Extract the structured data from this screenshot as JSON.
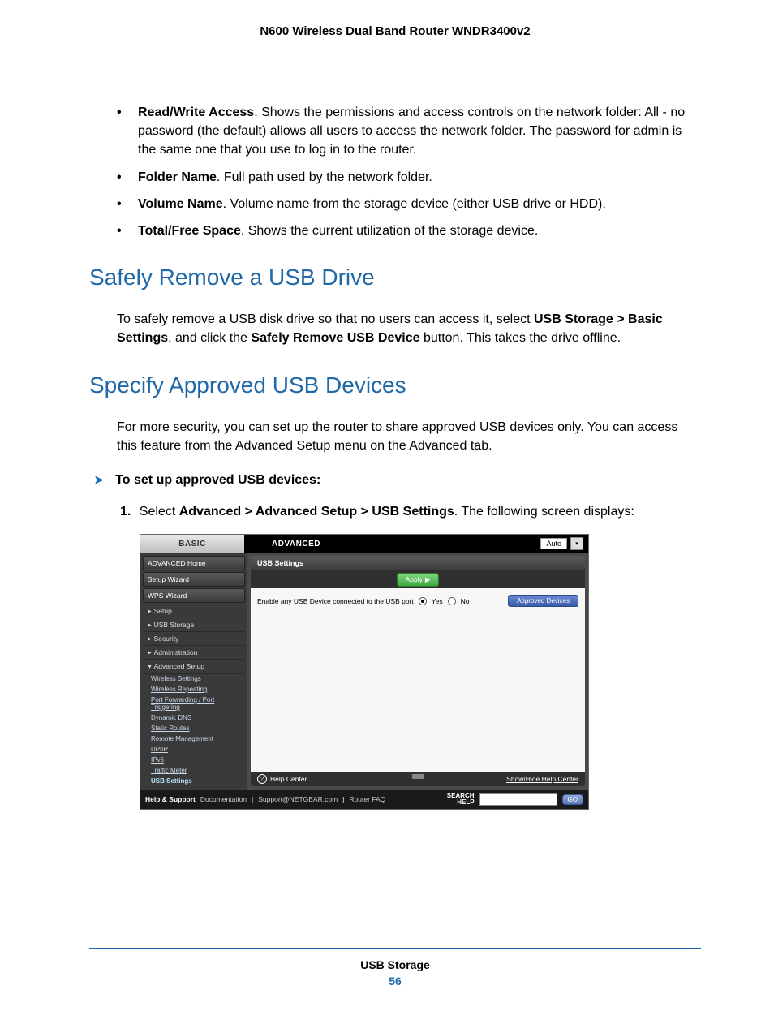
{
  "header": {
    "title": "N600 Wireless Dual Band Router WNDR3400v2"
  },
  "bullets": [
    {
      "term": "Read/Write Access",
      "text": ". Shows the permissions and access controls on the network folder: All - no password (the default) allows all users to access the network folder. The password for admin is the same one that you use to log in to the router."
    },
    {
      "term": "Folder Name",
      "text": ". Full path used by the network folder."
    },
    {
      "term": "Volume Name",
      "text": ". Volume name from the storage device (either USB drive or HDD)."
    },
    {
      "term": "Total/Free Space",
      "text": ". Shows the current utilization of the storage device."
    }
  ],
  "h2a": "Safely Remove a USB Drive",
  "para_a": {
    "pre": "To safely remove a USB disk drive so that no users can access it, select ",
    "b1": "USB Storage > Basic Settings",
    "mid": ", and click the ",
    "b2": "Safely Remove USB Device",
    "post": " button. This takes the drive offline."
  },
  "h2b": "Specify Approved USB Devices",
  "para_b": "For more security, you can set up the router to share approved USB devices only. You can access this feature from the Advanced Setup menu on the Advanced tab.",
  "proc_heading": "To set up approved USB devices:",
  "step1": {
    "pre": "Select ",
    "bold": "Advanced > Advanced Setup > USB Settings",
    "post": ". The following screen displays:"
  },
  "router": {
    "tabs": {
      "basic": "BASIC",
      "advanced": "ADVANCED",
      "auto": "Auto"
    },
    "side_buttons": [
      "ADVANCED Home",
      "Setup Wizard",
      "WPS Wizard"
    ],
    "side_rows": [
      {
        "label": "Setup",
        "expanded": false
      },
      {
        "label": "USB Storage",
        "expanded": false
      },
      {
        "label": "Security",
        "expanded": false
      },
      {
        "label": "Administration",
        "expanded": false
      },
      {
        "label": "Advanced Setup",
        "expanded": true
      }
    ],
    "side_subs": [
      "Wireless Settings",
      "Wireless Repeating",
      "Port Forwarding / Port Triggering",
      "Dynamic DNS",
      "Static Routes",
      "Remote Management",
      "UPnP",
      "IPv6",
      "Traffic Meter"
    ],
    "side_sub_active": "USB Settings",
    "panel_title": "USB Settings",
    "apply": "Apply",
    "enable_label": "Enable any USB Device connected to the USB port",
    "yes": "Yes",
    "no": "No",
    "approved_btn": "Approved Devices",
    "help_center": "Help Center",
    "show_hide": "Show/Hide Help Center",
    "footer": {
      "help_support": "Help & Support",
      "doc": "Documentation",
      "support": "Support@NETGEAR.com",
      "faq": "Router FAQ",
      "search": "SEARCH HELP",
      "go": "GO"
    }
  },
  "footer": {
    "section": "USB Storage",
    "page": "56"
  }
}
